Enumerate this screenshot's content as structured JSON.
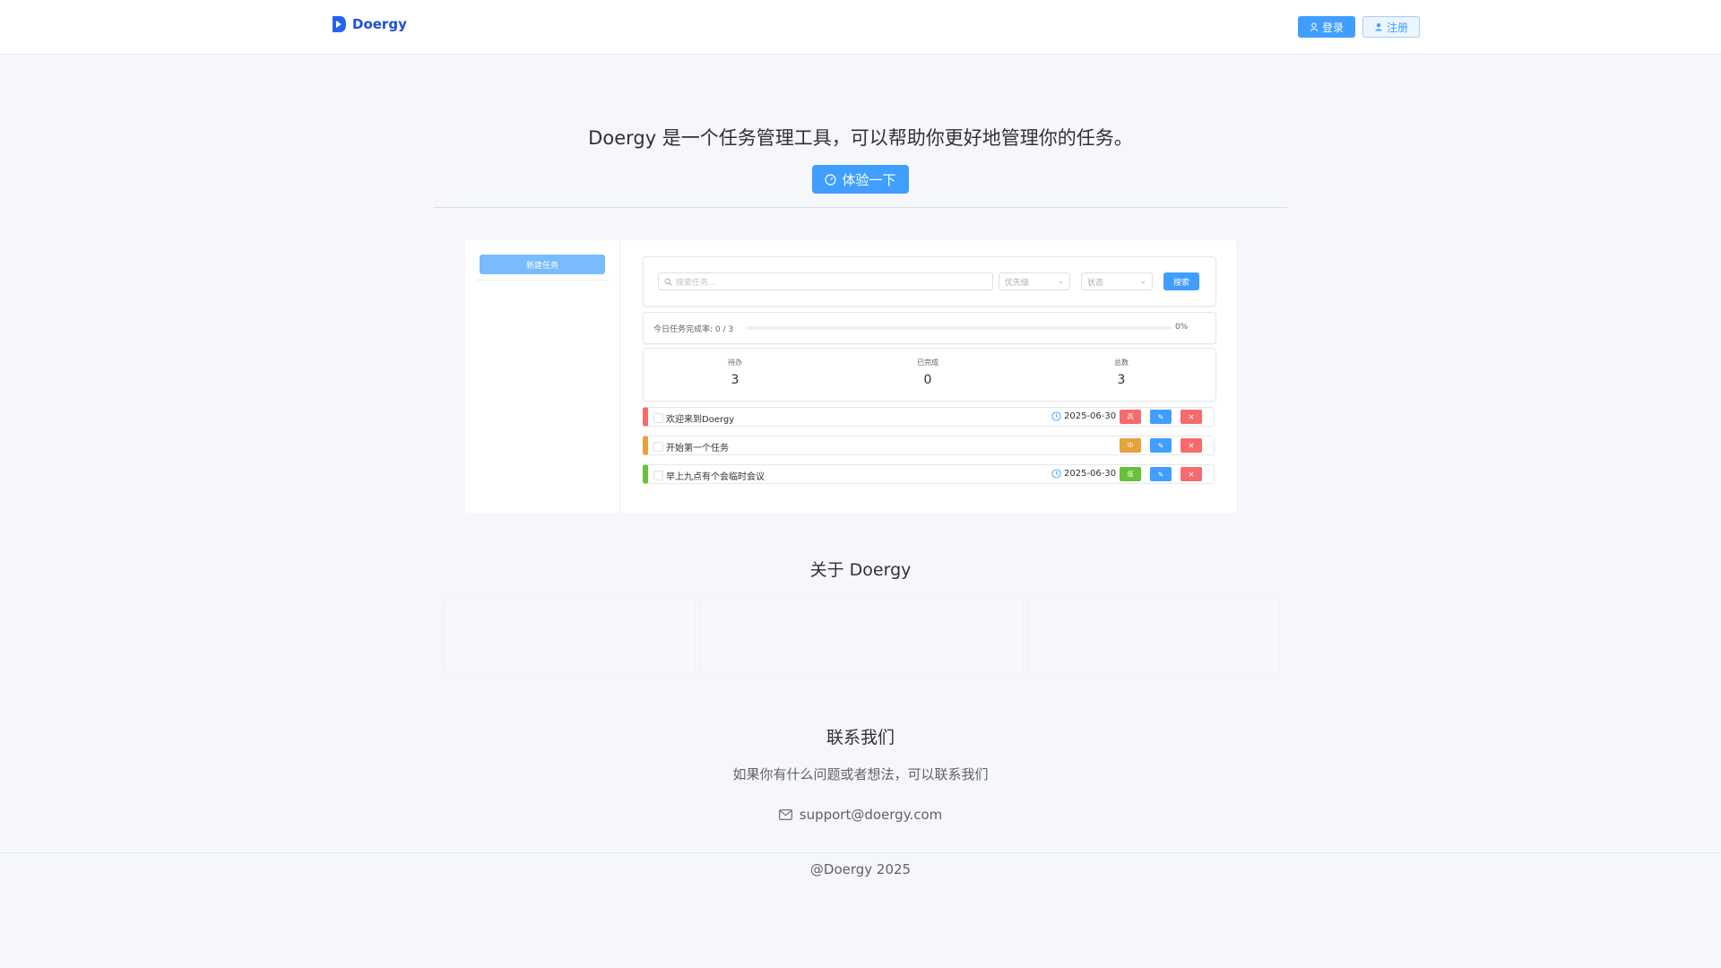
{
  "header": {
    "brand": "Doergy",
    "login_label": "登录",
    "register_label": "注册"
  },
  "hero": {
    "title": "Doergy 是一个任务管理工具，可以帮助你更好地管理你的任务。",
    "try_label": "体验一下"
  },
  "preview": {
    "new_task_label": "新建任务",
    "search_placeholder": "搜索任务...",
    "priority_placeholder": "优先级",
    "status_placeholder": "状态",
    "search_button": "搜索",
    "progress_label": "今日任务完成率:",
    "progress_count": "0 / 3",
    "progress_percent_text": "0%",
    "progress_value": 0,
    "stats": [
      {
        "label": "待办",
        "value": "3"
      },
      {
        "label": "已完成",
        "value": "0"
      },
      {
        "label": "总数",
        "value": "3"
      }
    ],
    "tasks": [
      {
        "title": "欢迎来到Doergy",
        "date": "2025-06-30",
        "priority": "高",
        "color": "#f56c6c"
      },
      {
        "title": "开始第一个任务",
        "date": "",
        "priority": "中",
        "color": "#e6a23c"
      },
      {
        "title": "早上九点有个会临时会议",
        "date": "2025-06-30",
        "priority": "低",
        "color": "#67c23a"
      }
    ],
    "edit_icon": "edit-icon",
    "delete_icon": "close-icon"
  },
  "about": {
    "title": "关于 Doergy"
  },
  "contact": {
    "title": "联系我们",
    "description": "如果你有什么问题或者想法，可以联系我们",
    "email": "support@doergy.com"
  },
  "footer": {
    "copyright": "@Doergy 2025"
  },
  "colors": {
    "primary": "#409eff",
    "danger": "#f56c6c",
    "warning": "#e6a23c",
    "success": "#67c23a",
    "brand": "#1d4ed8"
  }
}
